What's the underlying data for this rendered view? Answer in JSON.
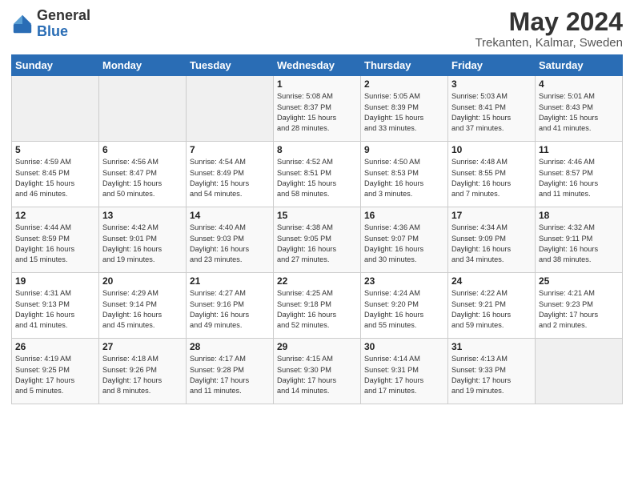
{
  "logo": {
    "general": "General",
    "blue": "Blue"
  },
  "title": {
    "month_year": "May 2024",
    "location": "Trekanten, Kalmar, Sweden"
  },
  "days_of_week": [
    "Sunday",
    "Monday",
    "Tuesday",
    "Wednesday",
    "Thursday",
    "Friday",
    "Saturday"
  ],
  "weeks": [
    [
      {
        "day": "",
        "info": ""
      },
      {
        "day": "",
        "info": ""
      },
      {
        "day": "",
        "info": ""
      },
      {
        "day": "1",
        "info": "Sunrise: 5:08 AM\nSunset: 8:37 PM\nDaylight: 15 hours\nand 28 minutes."
      },
      {
        "day": "2",
        "info": "Sunrise: 5:05 AM\nSunset: 8:39 PM\nDaylight: 15 hours\nand 33 minutes."
      },
      {
        "day": "3",
        "info": "Sunrise: 5:03 AM\nSunset: 8:41 PM\nDaylight: 15 hours\nand 37 minutes."
      },
      {
        "day": "4",
        "info": "Sunrise: 5:01 AM\nSunset: 8:43 PM\nDaylight: 15 hours\nand 41 minutes."
      }
    ],
    [
      {
        "day": "5",
        "info": "Sunrise: 4:59 AM\nSunset: 8:45 PM\nDaylight: 15 hours\nand 46 minutes."
      },
      {
        "day": "6",
        "info": "Sunrise: 4:56 AM\nSunset: 8:47 PM\nDaylight: 15 hours\nand 50 minutes."
      },
      {
        "day": "7",
        "info": "Sunrise: 4:54 AM\nSunset: 8:49 PM\nDaylight: 15 hours\nand 54 minutes."
      },
      {
        "day": "8",
        "info": "Sunrise: 4:52 AM\nSunset: 8:51 PM\nDaylight: 15 hours\nand 58 minutes."
      },
      {
        "day": "9",
        "info": "Sunrise: 4:50 AM\nSunset: 8:53 PM\nDaylight: 16 hours\nand 3 minutes."
      },
      {
        "day": "10",
        "info": "Sunrise: 4:48 AM\nSunset: 8:55 PM\nDaylight: 16 hours\nand 7 minutes."
      },
      {
        "day": "11",
        "info": "Sunrise: 4:46 AM\nSunset: 8:57 PM\nDaylight: 16 hours\nand 11 minutes."
      }
    ],
    [
      {
        "day": "12",
        "info": "Sunrise: 4:44 AM\nSunset: 8:59 PM\nDaylight: 16 hours\nand 15 minutes."
      },
      {
        "day": "13",
        "info": "Sunrise: 4:42 AM\nSunset: 9:01 PM\nDaylight: 16 hours\nand 19 minutes."
      },
      {
        "day": "14",
        "info": "Sunrise: 4:40 AM\nSunset: 9:03 PM\nDaylight: 16 hours\nand 23 minutes."
      },
      {
        "day": "15",
        "info": "Sunrise: 4:38 AM\nSunset: 9:05 PM\nDaylight: 16 hours\nand 27 minutes."
      },
      {
        "day": "16",
        "info": "Sunrise: 4:36 AM\nSunset: 9:07 PM\nDaylight: 16 hours\nand 30 minutes."
      },
      {
        "day": "17",
        "info": "Sunrise: 4:34 AM\nSunset: 9:09 PM\nDaylight: 16 hours\nand 34 minutes."
      },
      {
        "day": "18",
        "info": "Sunrise: 4:32 AM\nSunset: 9:11 PM\nDaylight: 16 hours\nand 38 minutes."
      }
    ],
    [
      {
        "day": "19",
        "info": "Sunrise: 4:31 AM\nSunset: 9:13 PM\nDaylight: 16 hours\nand 41 minutes."
      },
      {
        "day": "20",
        "info": "Sunrise: 4:29 AM\nSunset: 9:14 PM\nDaylight: 16 hours\nand 45 minutes."
      },
      {
        "day": "21",
        "info": "Sunrise: 4:27 AM\nSunset: 9:16 PM\nDaylight: 16 hours\nand 49 minutes."
      },
      {
        "day": "22",
        "info": "Sunrise: 4:25 AM\nSunset: 9:18 PM\nDaylight: 16 hours\nand 52 minutes."
      },
      {
        "day": "23",
        "info": "Sunrise: 4:24 AM\nSunset: 9:20 PM\nDaylight: 16 hours\nand 55 minutes."
      },
      {
        "day": "24",
        "info": "Sunrise: 4:22 AM\nSunset: 9:21 PM\nDaylight: 16 hours\nand 59 minutes."
      },
      {
        "day": "25",
        "info": "Sunrise: 4:21 AM\nSunset: 9:23 PM\nDaylight: 17 hours\nand 2 minutes."
      }
    ],
    [
      {
        "day": "26",
        "info": "Sunrise: 4:19 AM\nSunset: 9:25 PM\nDaylight: 17 hours\nand 5 minutes."
      },
      {
        "day": "27",
        "info": "Sunrise: 4:18 AM\nSunset: 9:26 PM\nDaylight: 17 hours\nand 8 minutes."
      },
      {
        "day": "28",
        "info": "Sunrise: 4:17 AM\nSunset: 9:28 PM\nDaylight: 17 hours\nand 11 minutes."
      },
      {
        "day": "29",
        "info": "Sunrise: 4:15 AM\nSunset: 9:30 PM\nDaylight: 17 hours\nand 14 minutes."
      },
      {
        "day": "30",
        "info": "Sunrise: 4:14 AM\nSunset: 9:31 PM\nDaylight: 17 hours\nand 17 minutes."
      },
      {
        "day": "31",
        "info": "Sunrise: 4:13 AM\nSunset: 9:33 PM\nDaylight: 17 hours\nand 19 minutes."
      },
      {
        "day": "",
        "info": ""
      }
    ]
  ]
}
